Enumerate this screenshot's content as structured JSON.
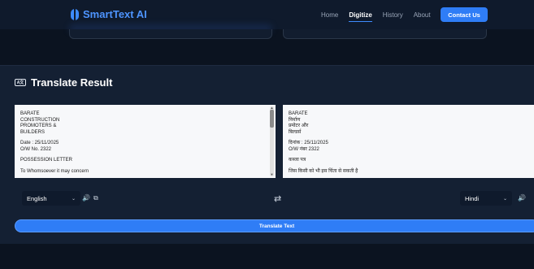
{
  "nav": {
    "brand": "SmartText AI",
    "links": [
      "Home",
      "Digitize",
      "History",
      "About"
    ],
    "active_link": "Digitize",
    "contact_label": "Contact Us"
  },
  "result": {
    "title": "Translate Result",
    "source": {
      "blocks": [
        "BARATE\nCONSTRUCTION\nPROMOTERS &\nBUILDERS",
        "Date : 25/11/2025\nO/W No. 2322",
        "POSSESSION LETTER",
        "To Whomsoever it may concern"
      ]
    },
    "target": {
      "blocks": [
        "BARATE\nनिर्माण\nप्रमोटर और\nबिल्डर्स",
        "दिनांक : 25/11/2025\nO/W नंबर 2322",
        "कब्जा पत्र",
        "जिस किसी को भी इस चिंता से सकती है"
      ]
    },
    "source_language": "English",
    "target_language": "Hindi",
    "translate_button": "Translate Text"
  },
  "icons": {
    "speaker": "speaker-icon",
    "copy": "copy-icon",
    "swap": "swap-icon",
    "chevron": "chevron-down-icon"
  },
  "colors": {
    "accent": "#2f7df6",
    "brand": "#4d94ff",
    "background": "#0b1320",
    "panel": "#142033"
  }
}
